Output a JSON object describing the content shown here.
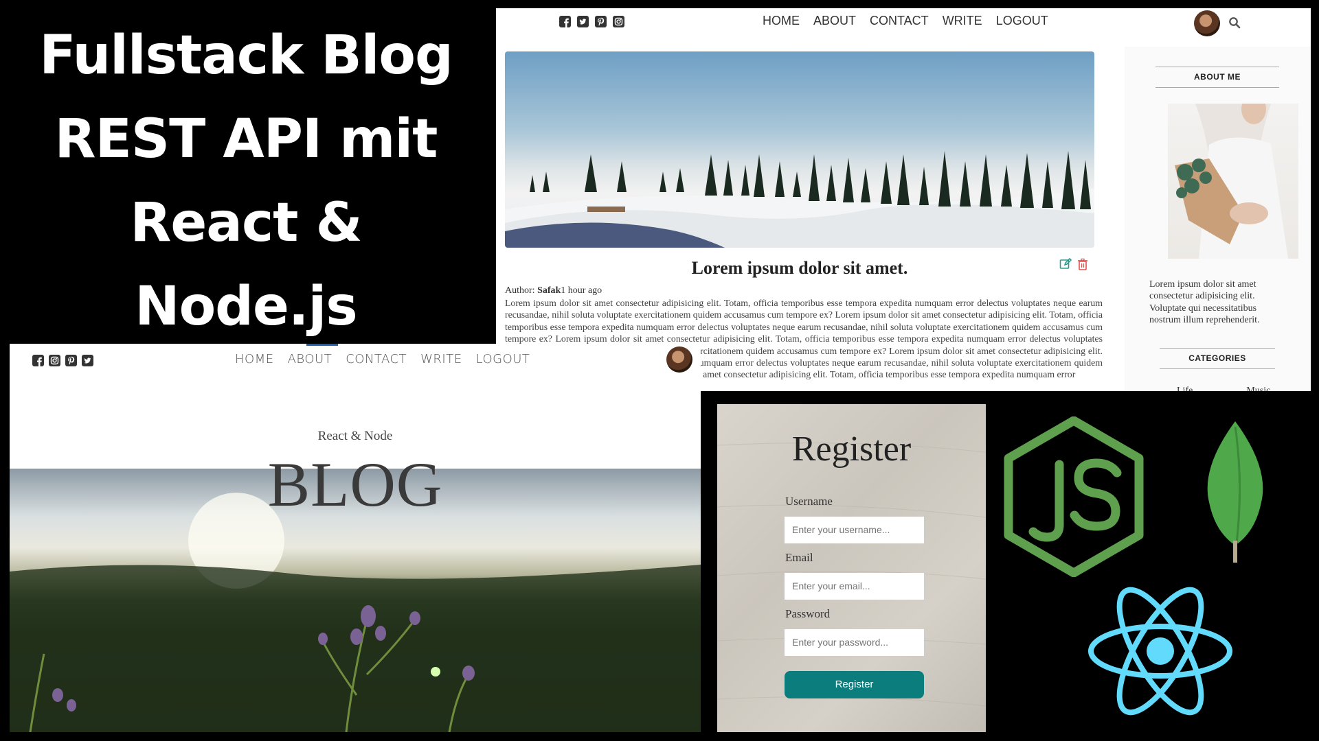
{
  "headline": {
    "lines": [
      "Fullstack Blog",
      "REST API mit",
      "React &",
      "Node.js"
    ]
  },
  "single_post": {
    "nav": [
      "HOME",
      "ABOUT",
      "CONTACT",
      "WRITE",
      "LOGOUT"
    ],
    "social_icons": [
      "facebook-icon",
      "twitter-icon",
      "pinterest-icon",
      "instagram-icon"
    ],
    "post_title": "Lorem ipsum dolor sit amet.",
    "author_label": "Author: ",
    "author_name": "Safak",
    "time": "1 hour ago",
    "body": "Lorem ipsum dolor sit amet consectetur adipisicing elit. Totam, officia temporibus esse tempora expedita numquam error delectus voluptates neque earum recusandae, nihil soluta voluptate exercitationem quidem accusamus cum tempore ex? Lorem ipsum dolor sit amet consectetur adipisicing elit. Totam, officia temporibus esse tempora expedita numquam error delectus voluptates neque earum recusandae, nihil soluta voluptate exercitationem quidem accusamus cum tempore ex? Lorem ipsum dolor sit amet consectetur adipisicing elit. Totam, officia temporibus esse tempora expedita numquam error delectus voluptates neque earum recusandae, nihil soluta voluptate exercitationem quidem accusamus cum tempore ex? Lorem ipsum dolor sit amet consectetur adipisicing elit. Totam, officia temporibus esse tempora expedita numquam error delectus voluptates neque earum recusandae, nihil soluta voluptate exercitationem quidem accusamus cum tempore ex? Lorem ipsum dolor sit amet consectetur adipisicing elit. Totam, officia temporibus esse tempora expedita numquam error",
    "sidebar": {
      "about_title": "ABOUT ME",
      "about_text": "Lorem ipsum dolor sit amet consectetur adipisicing elit. Voluptate qui necessitatibus nostrum illum reprehenderit.",
      "categories_title": "CATEGORIES",
      "categories": [
        "Life",
        "Music"
      ]
    }
  },
  "home": {
    "nav": [
      "HOME",
      "ABOUT",
      "CONTACT",
      "WRITE",
      "LOGOUT"
    ],
    "social_icons": [
      "facebook-icon",
      "instagram-icon",
      "pinterest-icon",
      "twitter-icon"
    ],
    "subtitle": "React & Node",
    "title": "BLOG"
  },
  "register": {
    "title": "Register",
    "username_label": "Username",
    "username_placeholder": "Enter your username...",
    "email_label": "Email",
    "email_placeholder": "Enter your email...",
    "password_label": "Password",
    "password_placeholder": "Enter your password...",
    "button": "Register",
    "button_color": "#0c7d7d"
  },
  "logos": {
    "node_color": "#5fa04e",
    "mongodb_color": "#4fa84a",
    "react_color": "#61dafb"
  }
}
